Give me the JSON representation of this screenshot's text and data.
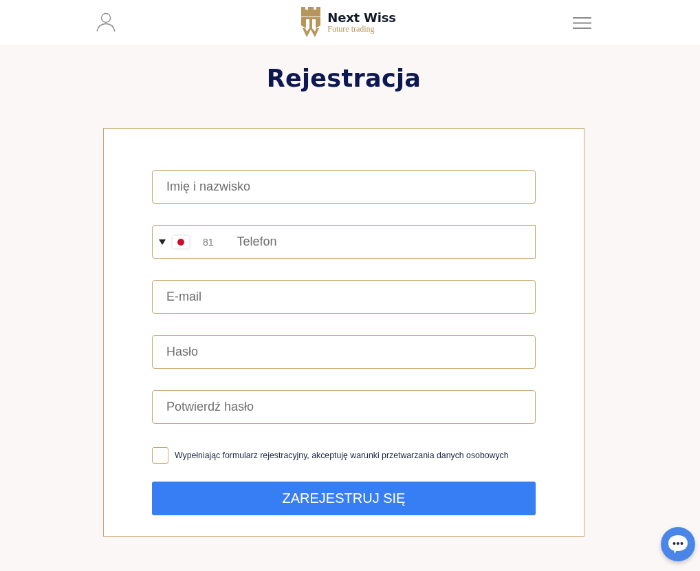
{
  "header": {
    "brand": {
      "name": "Next Wiss",
      "tagline": "Future trading"
    }
  },
  "title": "Rejestracja",
  "form": {
    "fields": [
      {
        "kind": "text",
        "placeholder": "Imię i nazwisko"
      },
      {
        "kind": "phone",
        "dial_code": "81",
        "placeholder": "Telefon"
      },
      {
        "kind": "text",
        "placeholder": "E-mail"
      },
      {
        "kind": "text",
        "placeholder": "Hasło"
      },
      {
        "kind": "text",
        "placeholder": "Potwierdź hasło"
      }
    ],
    "consent": {
      "label": "Wypełniając formularz rejestracyjny, akceptuję warunki przetwarzania danych osobowych",
      "checked": false
    },
    "submit": "ZAREJESTRUJ SIĘ"
  }
}
